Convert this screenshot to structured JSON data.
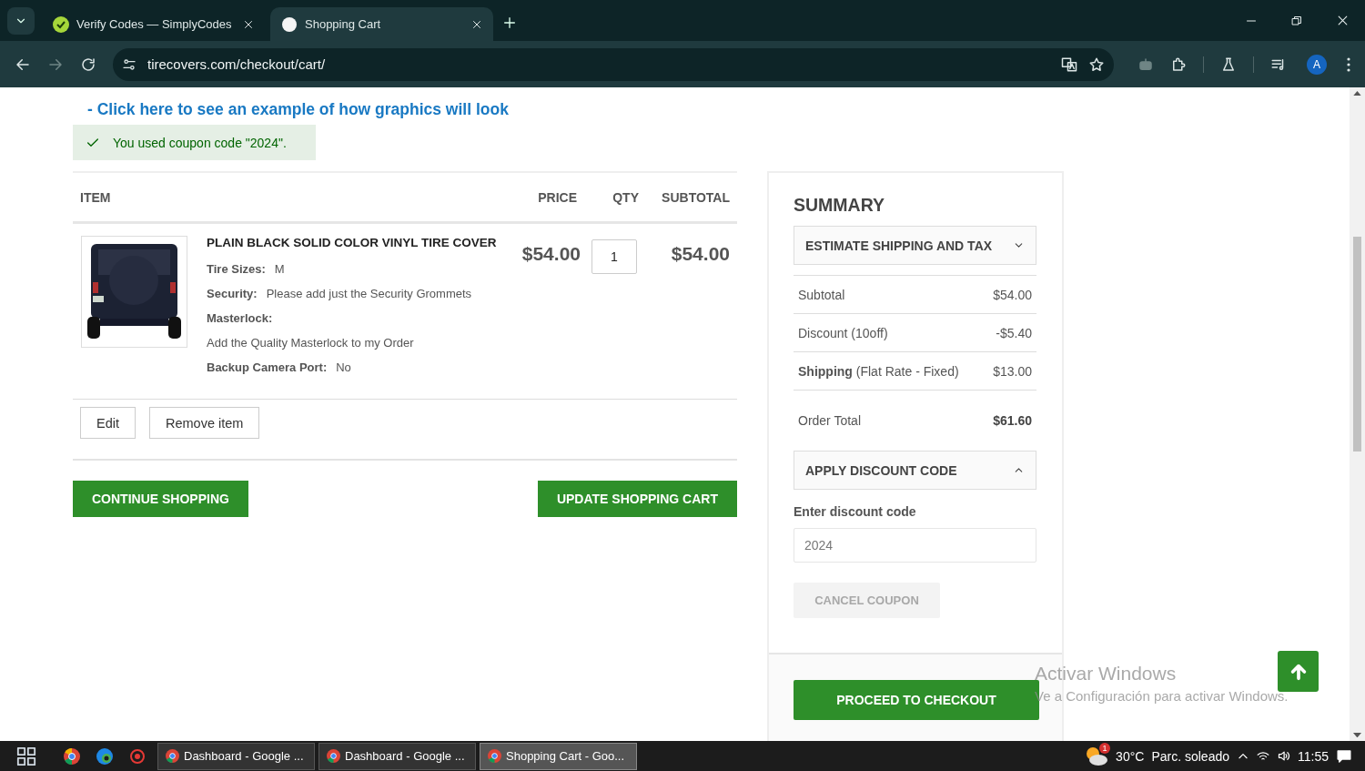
{
  "browser": {
    "tabs": [
      {
        "title": "Verify Codes — SimplyCodes",
        "selected": false
      },
      {
        "title": "Shopping Cart",
        "selected": true
      }
    ],
    "url": "tirecovers.com/checkout/cart/",
    "profile": "A"
  },
  "page": {
    "example_link": "- Click here to see an example of how graphics will look",
    "coupon_message": "You used coupon code \"2024\".",
    "cart": {
      "columns": [
        "ITEM",
        "PRICE",
        "QTY",
        "SUBTOTAL"
      ],
      "items": [
        {
          "name": "PLAIN BLACK SOLID COLOR VINYL TIRE COVER",
          "price": "$54.00",
          "qty": "1",
          "subtotal": "$54.00",
          "picture": {
            "kind": "picture"
          },
          "options": [
            {
              "label": "Tire Sizes:",
              "value": "M",
              "kind": "inline"
            },
            {
              "label": "Security:",
              "value": "Please add just the Security Grommets",
              "kind": "inline"
            },
            {
              "label": "Masterlock:",
              "value": "Add the Quality Masterlock to my Order",
              "kind": "below"
            },
            {
              "label": "Backup Camera Port:",
              "value": "No",
              "kind": "inline"
            }
          ],
          "actions": [
            "Edit",
            "Remove item"
          ]
        }
      ],
      "continue_button": "CONTINUE SHOPPING",
      "update_button": "UPDATE SHOPPING CART"
    },
    "summary": {
      "title": "SUMMARY",
      "estimate": {
        "label": "ESTIMATE SHIPPING AND TAX",
        "expanded": false
      },
      "rows": [
        {
          "label": "Subtotal",
          "value": "$54.00"
        },
        {
          "label": "Discount (10off)",
          "value": "-$5.40"
        },
        {
          "label": "**Shipping** (Flat Rate - Fixed)",
          "value": "$13.00"
        }
      ],
      "order_total": {
        "label": "Order Total",
        "value": "$61.60"
      },
      "discount": {
        "label": "APPLY DISCOUNT CODE",
        "expanded": true,
        "field_label": "Enter discount code",
        "value": "2024",
        "cancel_button": {
          "label": "CANCEL COUPON",
          "disabled": true
        }
      },
      "checkout_button": "PROCEED TO CHECKOUT"
    }
  },
  "os_notice": {
    "title": "Activar Windows",
    "text": "Ve a Configuración para activar Windows."
  },
  "taskbar": {
    "windows": [
      {
        "label": "Dashboard - Google ...",
        "selected": false
      },
      {
        "label": "Dashboard - Google ...",
        "selected": false
      },
      {
        "label": "Shopping Cart - Goo...",
        "selected": true
      }
    ],
    "weather": {
      "badge": "1",
      "temperature": "30°C",
      "condition": "Parc. soleado"
    },
    "time": "11:55"
  }
}
